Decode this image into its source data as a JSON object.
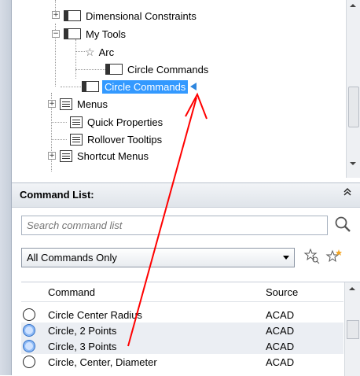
{
  "tree": {
    "items": [
      {
        "label": "Dimensional Constraints",
        "icon": "toolbar-icon"
      },
      {
        "label": "My Tools",
        "icon": "toolbar-icon"
      },
      {
        "label": "Arc",
        "icon": "star-icon"
      },
      {
        "label": "Circle Commands",
        "icon": "toolbar-icon"
      },
      {
        "label": "Circle Commands",
        "icon": "toolbar-icon",
        "selected": true
      },
      {
        "label": "Menus",
        "icon": "menu-icon"
      },
      {
        "label": "Quick Properties",
        "icon": "properties-icon"
      },
      {
        "label": "Rollover Tooltips",
        "icon": "tooltip-icon"
      },
      {
        "label": "Shortcut Menus",
        "icon": "shortcut-menu-icon"
      }
    ]
  },
  "command_list": {
    "title": "Command List:",
    "search_placeholder": "Search command list",
    "filter_value": "All Commands Only",
    "columns": {
      "command": "Command",
      "source": "Source"
    },
    "rows": [
      {
        "command": "Circle Center Radius",
        "source": "ACAD"
      },
      {
        "command": "Circle, 2 Points",
        "source": "ACAD"
      },
      {
        "command": "Circle, 3 Points",
        "source": "ACAD"
      },
      {
        "command": "Circle, Center, Diameter",
        "source": "ACAD"
      }
    ]
  },
  "colors": {
    "selection": "#3399ff",
    "annotation_arrow": "#ff0000"
  }
}
